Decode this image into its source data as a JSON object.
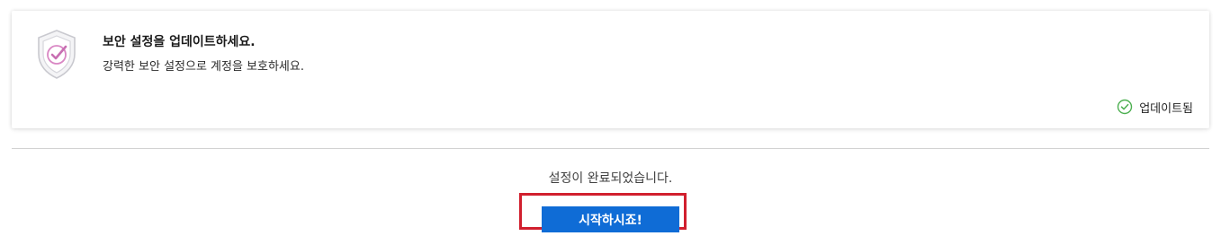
{
  "security_card": {
    "title": "보안 설정을 업데이트하세요.",
    "description": "강력한 보안 설정으로 계정을 보호하세요.",
    "status_label": "업데이트됨",
    "icon": "shield-check-icon",
    "status_icon": "check-circle-icon"
  },
  "footer": {
    "message": "설정이 완료되었습니다.",
    "start_button_label": "시작하시죠!"
  },
  "colors": {
    "primary": "#0f6cd6",
    "highlight": "#d11f2e",
    "success": "#4caf50",
    "shield_accent": "#d987c4"
  }
}
